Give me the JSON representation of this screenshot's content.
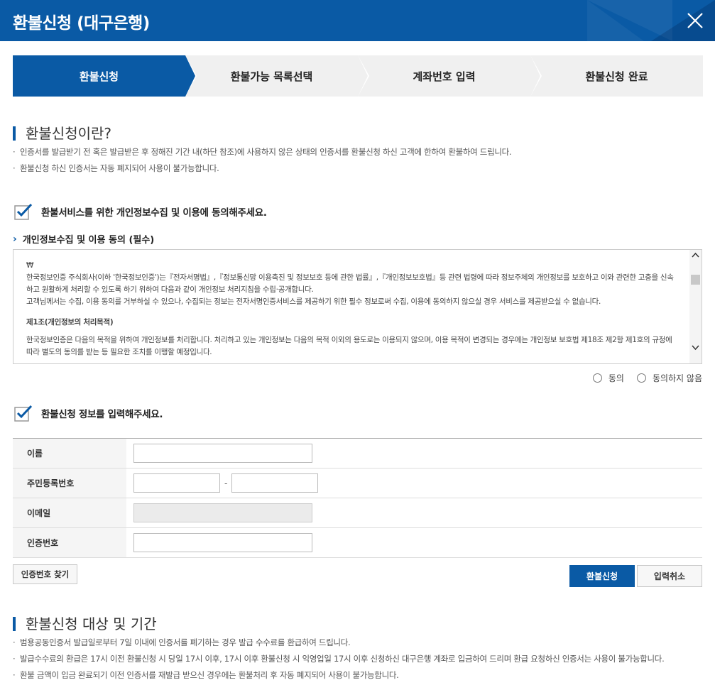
{
  "header": {
    "title": "환불신청 (대구은행)",
    "close_icon": "close-icon"
  },
  "steps": [
    {
      "label": "환불신청",
      "active": true
    },
    {
      "label": "환불가능 목록선택",
      "active": false
    },
    {
      "label": "계좌번호 입력",
      "active": false
    },
    {
      "label": "환불신청 완료",
      "active": false
    }
  ],
  "intro": {
    "title": "환불신청이란?",
    "bullets": [
      "인증서를 발급받기 전 혹은 발급받은 후 정해진 기간 내(하단 참조)에 사용하지 않은 상태의 인증서를 환불신청 하신 고객에 한하여 환불하여 드립니다.",
      "환불신청 하신 인증서는 자동 폐지되어 사용이 불가능합니다."
    ]
  },
  "privacy": {
    "heading": "환불서비스를 위한 개인정보수집 및 이용에 동의해주세요.",
    "sub_heading": "개인정보수집 및 이용 동의 (필수)",
    "terms": {
      "line0": "₩",
      "p1": "한국정보인증 주식회사(이하 '한국정보인증')는『전자서명법』,『정보통신망 이용촉진 및 정보보호 등에 관한 법률』,『개인정보보호법』등 관련 법령에 따라 정보주체의 개인정보를 보호하고 이와 관련한 고충을 신속하고 원활하게 처리할 수 있도록 하기 위하여 다음과 같이 개인정보 처리지침을 수립·공개합니다.",
      "p2": "고객님께서는 수집, 이용 동의를 거부하실 수 있으나, 수집되는 정보는 전자서명인증서비스를 제공하기 위한 필수 정보로써 수집, 이용에 동의하지 않으실 경우 서비스를 제공받으실 수 없습니다.",
      "h1": "제1조(개인정보의 처리목적)",
      "p3": "한국정보인증은 다음의 목적을 위하여 개인정보를 처리합니다. 처리하고 있는 개인정보는 다음의 목적 이외의 용도로는 이용되지 않으며, 이용 목적이 변경되는 경우에는 개인정보 보호법 제18조 제2항 제1호의 규정에 따라 별도의 동의를 받는 등 필요한 조치를 이행할 예정입니다."
    },
    "agree_label": "동의",
    "disagree_label": "동의하지 않음"
  },
  "form": {
    "heading": "환불신청 정보를 입력해주세요.",
    "name_label": "이름",
    "rrn_label": "주민등록번호",
    "rrn_separator": "-",
    "email_label": "이메일",
    "auth_label": "인증번호",
    "find_auth_button": "인증번호 찾기",
    "submit_button": "환불신청",
    "cancel_button": "입력취소"
  },
  "period": {
    "title": "환불신청 대상 및 기간",
    "bullets": [
      "범용공동인증서 발급일로부터 7일 이내에 인증서를 폐기하는 경우 발급 수수료를 환급하여 드립니다.",
      "발급수수료의 환급은 17시 이전 환불신청 시 당일 17시 이후, 17시 이후 환불신청 시 익영업일 17시 이후 신청하신 대구은행 계좌로 입금하여 드리며 환급 요청하신 인증서는 사용이 불가능합니다.",
      "환불 금액이 입금 완료되기 이전 인증서를 재발급 받으신 경우에는 환불처리 후 자동 폐지되어 사용이 불가능합니다."
    ]
  },
  "colors": {
    "primary": "#0a5aa5",
    "step_inactive": "#f0f0f0"
  }
}
